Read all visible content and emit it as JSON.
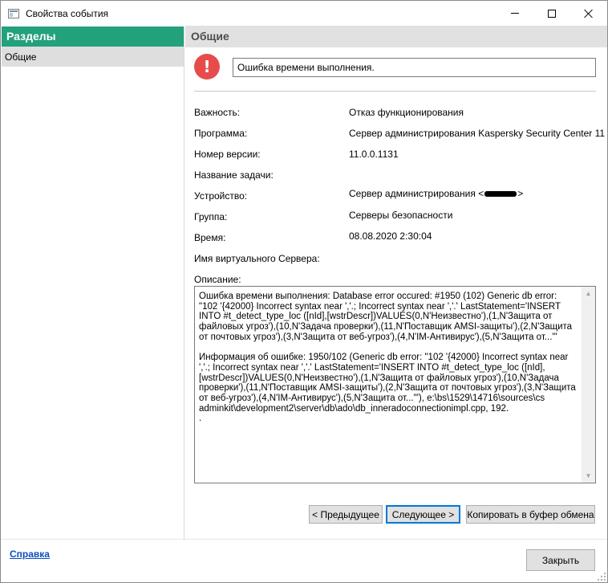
{
  "window": {
    "title": "Свойства события"
  },
  "sidebar": {
    "header": "Разделы",
    "items": [
      {
        "label": "Общие"
      }
    ]
  },
  "main": {
    "header": "Общие",
    "error_summary": "Ошибка времени выполнения.",
    "properties": [
      {
        "label": "Важность:",
        "value": "Отказ функционирования"
      },
      {
        "label": "Программа:",
        "value": "Сервер администрирования Kaspersky Security Center 11"
      },
      {
        "label": "Номер версии:",
        "value": "11.0.0.1131"
      },
      {
        "label": "Название задачи:",
        "value": ""
      },
      {
        "label": "Устройство:",
        "value": "Сервер администрирования <",
        "value_suffix": ">"
      },
      {
        "label": "Группа:",
        "value": "Серверы безопасности"
      },
      {
        "label": "Время:",
        "value": "08.08.2020 2:30:04"
      },
      {
        "label": "Имя виртуального Сервера:",
        "value": ""
      }
    ],
    "description_label": "Описание:",
    "description_text": "Ошибка времени выполнения: Database error occured: #1950 (102) Generic db error: \"102 '{42000} Incorrect syntax near ','.; Incorrect syntax near ','.' LastStatement='INSERT INTO #t_detect_type_loc ([nId],[wstrDescr])VALUES(0,N'Неизвестно'),(1,N'Защита от файловых угроз'),(10,N'Задача проверки'),(11,N'Поставщик AMSI-защиты'),(2,N'Защита от почтовых угроз'),(3,N'Защита от веб-угроз'),(4,N'IM-Антивирус'),(5,N'Защита от...'\"\n\nИнформация об ошибке: 1950/102 (Generic db error: \"102 '{42000} Incorrect syntax near ','.; Incorrect syntax near ','.' LastStatement='INSERT INTO #t_detect_type_loc ([nId],[wstrDescr])VALUES(0,N'Неизвестно'),(1,N'Защита от файловых угроз'),(10,N'Задача проверки'),(11,N'Поставщик AMSI-защиты'),(2,N'Защита от почтовых угроз'),(3,N'Защита от веб-угроз'),(4,N'IM-Антивирус'),(5,N'Защита от...'\"), e:\\bs\\1529\\14716\\sources\\cs adminkit\\development2\\server\\db\\ado\\db_inneradoconnectionimpl.cpp, 192.\n."
  },
  "buttons": {
    "prev": "< Предыдущее",
    "next": "Следующее >",
    "copy": "Копировать в буфер обмена",
    "close": "Закрыть"
  },
  "footer": {
    "help_link": "Справка"
  },
  "colors": {
    "sidebar_header_bg": "#23a07c",
    "error_icon": "#e74c4c",
    "link": "#0b4fbf",
    "focus_border": "#0078d7"
  },
  "icons": {
    "app": "window-app-icon",
    "error": "error-exclamation-icon",
    "minimize": "minimize-icon",
    "maximize": "maximize-icon",
    "close": "close-icon"
  }
}
